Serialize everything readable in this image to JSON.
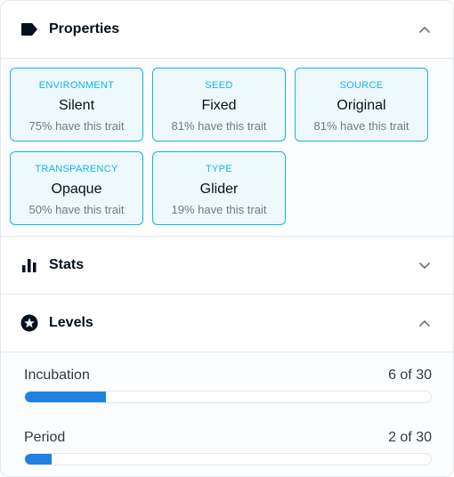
{
  "properties": {
    "title": "Properties",
    "icon": "tag-icon",
    "expanded": true,
    "traits": [
      {
        "type": "ENVIRONMENT",
        "value": "Silent",
        "rarity": "75% have this trait"
      },
      {
        "type": "SEED",
        "value": "Fixed",
        "rarity": "81% have this trait"
      },
      {
        "type": "SOURCE",
        "value": "Original",
        "rarity": "81% have this trait"
      },
      {
        "type": "TRANSPARENCY",
        "value": "Opaque",
        "rarity": "50% have this trait"
      },
      {
        "type": "TYPE",
        "value": "Glider",
        "rarity": "19% have this trait"
      }
    ]
  },
  "stats": {
    "title": "Stats",
    "icon": "bar-chart-icon",
    "expanded": false
  },
  "levels": {
    "title": "Levels",
    "icon": "star-circle-icon",
    "expanded": true,
    "items": [
      {
        "name": "Incubation",
        "label": "6 of 30",
        "value": 6,
        "max": 30
      },
      {
        "name": "Period",
        "label": "2 of 30",
        "value": 2,
        "max": 30
      }
    ]
  },
  "colors": {
    "accent": "#2081e2",
    "trait_border": "#15b2e5",
    "trait_bg": "#eef9fd"
  }
}
